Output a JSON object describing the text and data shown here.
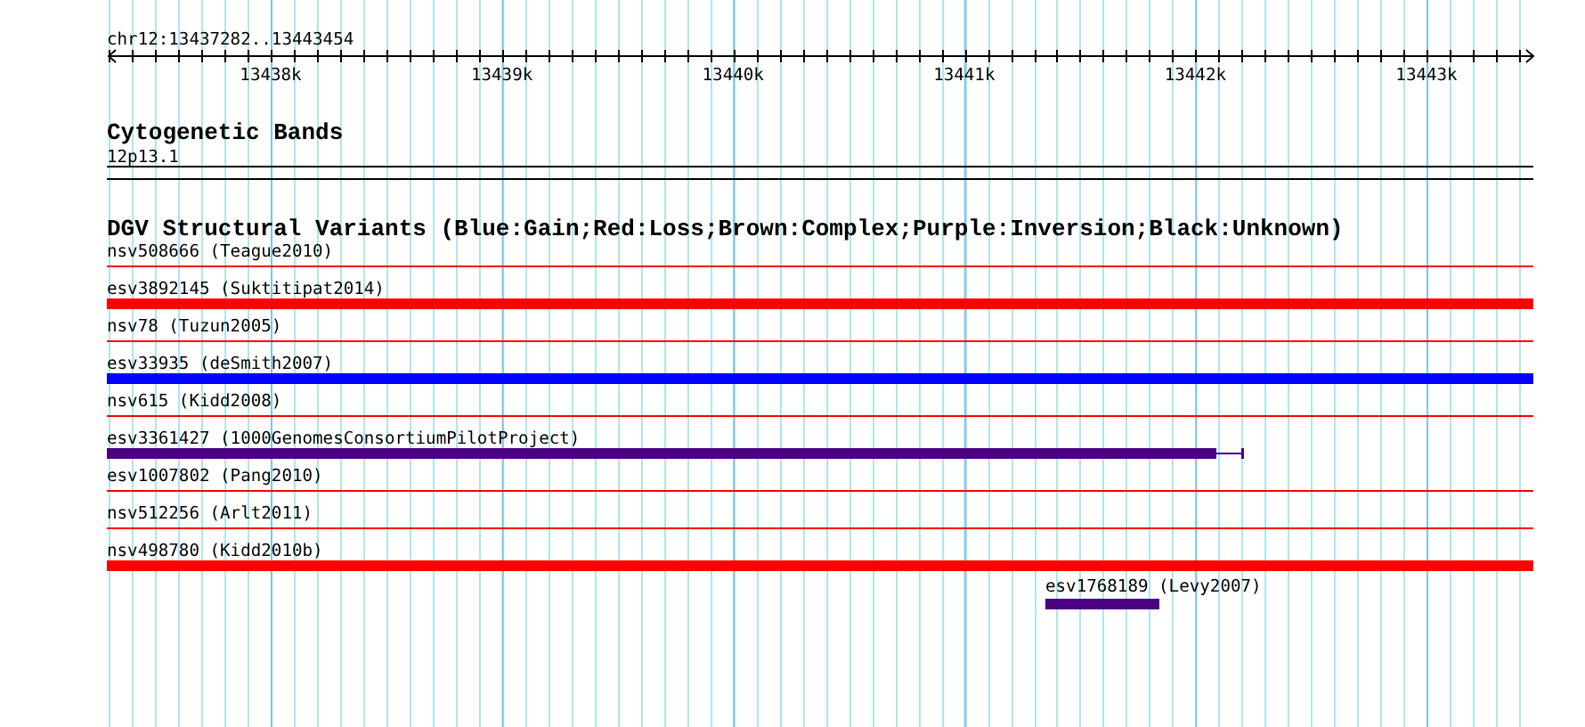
{
  "scale": {
    "region": "chr12:13437282..13443454",
    "ticks": [
      "13438k",
      "13439k",
      "13440k",
      "13441k",
      "13442k",
      "13443k"
    ]
  },
  "cytoband": {
    "title": "Cytogenetic Bands",
    "band": "12p13.1"
  },
  "dgv": {
    "title": "DGV Structural Variants (Blue:Gain;Red:Loss;Brown:Complex;Purple:Inversion;Black:Unknown)",
    "variants": [
      {
        "label": "nsv508666 (Teague2010)",
        "kind": "line",
        "color": "#ff0000"
      },
      {
        "label": "esv3892145 (Suktitipat2014)",
        "kind": "bar",
        "color": "#ff0000"
      },
      {
        "label": "nsv78 (Tuzun2005)",
        "kind": "line",
        "color": "#ff0000"
      },
      {
        "label": "esv33935 (deSmith2007)",
        "kind": "bar",
        "color": "#0000ff"
      },
      {
        "label": "nsv615 (Kidd2008)",
        "kind": "line",
        "color": "#ff0000"
      },
      {
        "label": "esv3361427 (1000GenomesConsortiumPilotProject)",
        "kind": "bar-whisker",
        "color": "#4b0082"
      },
      {
        "label": "esv1007802 (Pang2010)",
        "kind": "line",
        "color": "#ff0000"
      },
      {
        "label": "nsv512256 (Arlt2011)",
        "kind": "line",
        "color": "#ff0000"
      },
      {
        "label": "nsv498780 (Kidd2010b)",
        "kind": "bar",
        "color": "#ff0000"
      },
      {
        "label": "esv1768189 (Levy2007)",
        "kind": "bar",
        "color": "#4b0082"
      }
    ]
  }
}
